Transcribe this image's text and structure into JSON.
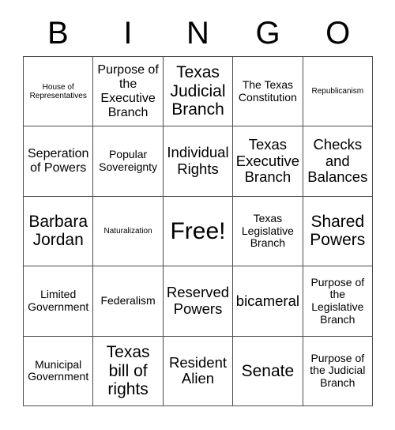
{
  "header": {
    "letters": [
      "B",
      "I",
      "N",
      "G",
      "O"
    ]
  },
  "grid": {
    "rows": [
      [
        {
          "text": "House of Representatives",
          "size": "xs"
        },
        {
          "text": "Purpose of the Executive Branch",
          "size": "l"
        },
        {
          "text": "Texas Judicial Branch",
          "size": "xxl"
        },
        {
          "text": "The Texas Constitution",
          "size": "m"
        },
        {
          "text": "Republicanism",
          "size": "xs"
        }
      ],
      [
        {
          "text": "Seperation of Powers",
          "size": "l"
        },
        {
          "text": "Popular Sovereignty",
          "size": "m"
        },
        {
          "text": "Individual Rights",
          "size": "xl"
        },
        {
          "text": "Texas Executive Branch",
          "size": "xl"
        },
        {
          "text": "Checks and Balances",
          "size": "xl"
        }
      ],
      [
        {
          "text": "Barbara Jordan",
          "size": "xxl"
        },
        {
          "text": "Naturalization",
          "size": "xs"
        },
        {
          "text": "Free!",
          "size": "free"
        },
        {
          "text": "Texas Legislative Branch",
          "size": "m"
        },
        {
          "text": "Shared Powers",
          "size": "xxl"
        }
      ],
      [
        {
          "text": "Limited Government",
          "size": "m"
        },
        {
          "text": "Federalism",
          "size": "m"
        },
        {
          "text": "Reserved Powers",
          "size": "xl"
        },
        {
          "text": "bicameral",
          "size": "xl"
        },
        {
          "text": "Purpose of the Legislative Branch",
          "size": "m"
        }
      ],
      [
        {
          "text": "Municipal Government",
          "size": "m"
        },
        {
          "text": "Texas bill of rights",
          "size": "xxl"
        },
        {
          "text": "Resident Alien",
          "size": "xl"
        },
        {
          "text": "Senate",
          "size": "xxl"
        },
        {
          "text": "Purpose of the Judicial Branch",
          "size": "m"
        }
      ]
    ]
  },
  "colors": {
    "border": "#4d4d4d",
    "text": "#000000",
    "background": "#ffffff"
  }
}
